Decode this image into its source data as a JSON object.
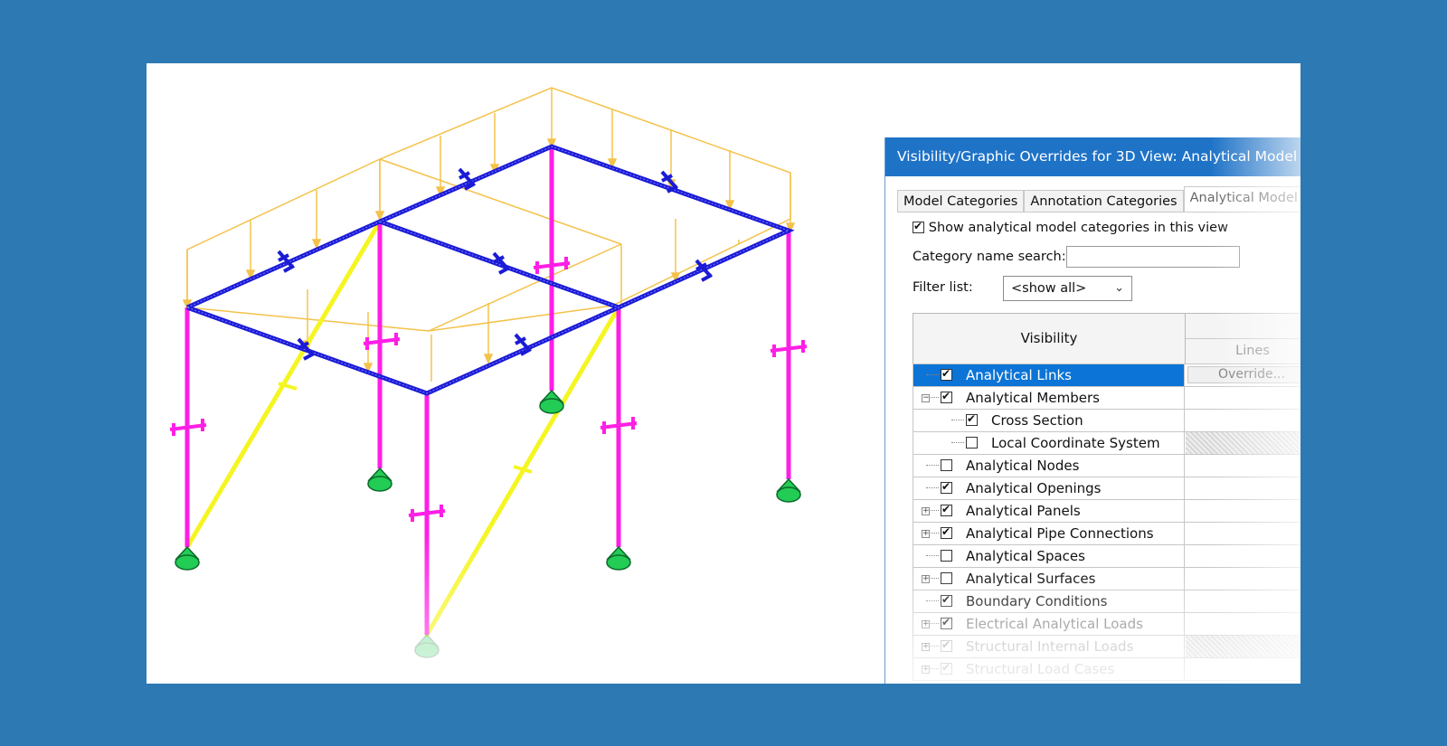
{
  "colors": {
    "background": "#2d79b3",
    "title_bar": "#1f73c7",
    "selection": "#0b74d6",
    "beams": "#1b1bd6",
    "columns": "#ff1ee6",
    "braces": "#f5f522",
    "loads": "#f4c24a",
    "supports": "#22cc55"
  },
  "dialog": {
    "title": "Visibility/Graphic Overrides for 3D View: Analytical Model",
    "tabs": [
      {
        "label": "Model Categories",
        "active": false
      },
      {
        "label": "Annotation Categories",
        "active": false
      },
      {
        "label": "Analytical Model Ca",
        "active": true
      }
    ],
    "show_checkbox": {
      "label": "Show analytical model categories in this view",
      "checked": true
    },
    "search": {
      "label": "Category name search:",
      "value": ""
    },
    "filter": {
      "label": "Filter list:",
      "value": "<show all>"
    },
    "grid": {
      "header_visibility": "Visibility",
      "header_lines": "Lines",
      "override_label": "Override...",
      "rows": [
        {
          "label": "Analytical Links",
          "checked": true,
          "level": 0,
          "expander": "",
          "selected": true
        },
        {
          "label": "Analytical Members",
          "checked": true,
          "level": 0,
          "expander": "-"
        },
        {
          "label": "Cross Section",
          "checked": true,
          "level": 1,
          "expander": ""
        },
        {
          "label": "Local Coordinate System",
          "checked": false,
          "level": 1,
          "expander": "",
          "hatched": true
        },
        {
          "label": "Analytical Nodes",
          "checked": false,
          "level": 0,
          "expander": ""
        },
        {
          "label": "Analytical Openings",
          "checked": true,
          "level": 0,
          "expander": ""
        },
        {
          "label": "Analytical Panels",
          "checked": true,
          "level": 0,
          "expander": "+"
        },
        {
          "label": "Analytical Pipe Connections",
          "checked": true,
          "level": 0,
          "expander": "+"
        },
        {
          "label": "Analytical Spaces",
          "checked": false,
          "level": 0,
          "expander": ""
        },
        {
          "label": "Analytical Surfaces",
          "checked": false,
          "level": 0,
          "expander": "+"
        },
        {
          "label": "Boundary Conditions",
          "checked": true,
          "level": 0,
          "expander": ""
        },
        {
          "label": "Electrical Analytical Loads",
          "checked": true,
          "level": 0,
          "expander": "+",
          "dim": true
        },
        {
          "label": "Structural Internal Loads",
          "checked": true,
          "level": 0,
          "expander": "+",
          "faint": true,
          "hatched": true
        },
        {
          "label": "Structural Load Cases",
          "checked": true,
          "level": 0,
          "expander": "+",
          "faint": true
        }
      ]
    }
  },
  "model": {
    "icons": [
      "beam-section-icon",
      "column-section-icon",
      "support-icon"
    ]
  }
}
